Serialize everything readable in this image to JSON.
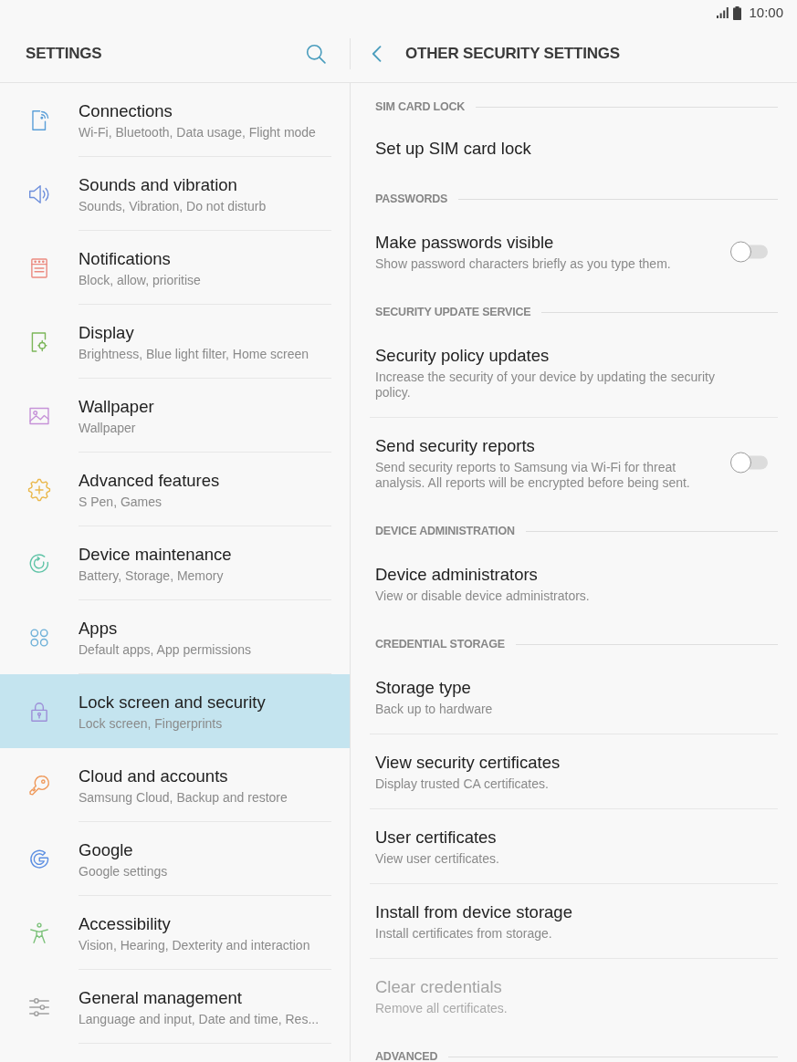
{
  "status_bar": {
    "time": "10:00"
  },
  "sidebar": {
    "title": "SETTINGS",
    "items": [
      {
        "title": "Connections",
        "subtitle": "Wi-Fi, Bluetooth, Data usage, Flight mode",
        "selected": false
      },
      {
        "title": "Sounds and vibration",
        "subtitle": "Sounds, Vibration, Do not disturb",
        "selected": false
      },
      {
        "title": "Notifications",
        "subtitle": "Block, allow, prioritise",
        "selected": false
      },
      {
        "title": "Display",
        "subtitle": "Brightness, Blue light filter, Home screen",
        "selected": false
      },
      {
        "title": "Wallpaper",
        "subtitle": "Wallpaper",
        "selected": false
      },
      {
        "title": "Advanced features",
        "subtitle": "S Pen, Games",
        "selected": false
      },
      {
        "title": "Device maintenance",
        "subtitle": "Battery, Storage, Memory",
        "selected": false
      },
      {
        "title": "Apps",
        "subtitle": "Default apps, App permissions",
        "selected": false
      },
      {
        "title": "Lock screen and security",
        "subtitle": "Lock screen, Fingerprints",
        "selected": true
      },
      {
        "title": "Cloud and accounts",
        "subtitle": "Samsung Cloud, Backup and restore",
        "selected": false
      },
      {
        "title": "Google",
        "subtitle": "Google settings",
        "selected": false
      },
      {
        "title": "Accessibility",
        "subtitle": "Vision, Hearing, Dexterity and interaction",
        "selected": false
      },
      {
        "title": "General management",
        "subtitle": "Language and input, Date and time, Res...",
        "selected": false
      }
    ]
  },
  "detail": {
    "title": "OTHER SECURITY SETTINGS",
    "sections": [
      {
        "heading": "SIM CARD LOCK",
        "items": [
          {
            "kind": "plain",
            "title": "Set up SIM card lock",
            "disabled": false
          }
        ]
      },
      {
        "heading": "PASSWORDS",
        "items": [
          {
            "kind": "switch",
            "title": "Make passwords visible",
            "subtitle": "Show password characters briefly as you type them.",
            "on": false,
            "disabled": false
          }
        ]
      },
      {
        "heading": "SECURITY UPDATE SERVICE",
        "items": [
          {
            "kind": "plain",
            "title": "Security policy updates",
            "subtitle": "Increase the security of your device by updating the security policy.",
            "disabled": false
          },
          {
            "kind": "switch",
            "title": "Send security reports",
            "subtitle": "Send security reports to Samsung via Wi-Fi for threat analysis. All reports will be encrypted before being sent.",
            "on": false,
            "disabled": false
          }
        ]
      },
      {
        "heading": "DEVICE ADMINISTRATION",
        "items": [
          {
            "kind": "plain",
            "title": "Device administrators",
            "subtitle": "View or disable device administrators.",
            "disabled": false
          }
        ]
      },
      {
        "heading": "CREDENTIAL STORAGE",
        "items": [
          {
            "kind": "plain",
            "title": "Storage type",
            "subtitle": "Back up to hardware",
            "disabled": false
          },
          {
            "kind": "plain",
            "title": "View security certificates",
            "subtitle": "Display trusted CA certificates.",
            "disabled": false
          },
          {
            "kind": "plain",
            "title": "User certificates",
            "subtitle": "View user certificates.",
            "disabled": false
          },
          {
            "kind": "plain",
            "title": "Install from device storage",
            "subtitle": "Install certificates from storage.",
            "disabled": false
          },
          {
            "kind": "plain",
            "title": "Clear credentials",
            "subtitle": "Remove all certificates.",
            "disabled": true
          }
        ]
      },
      {
        "heading": "ADVANCED"
      }
    ]
  }
}
